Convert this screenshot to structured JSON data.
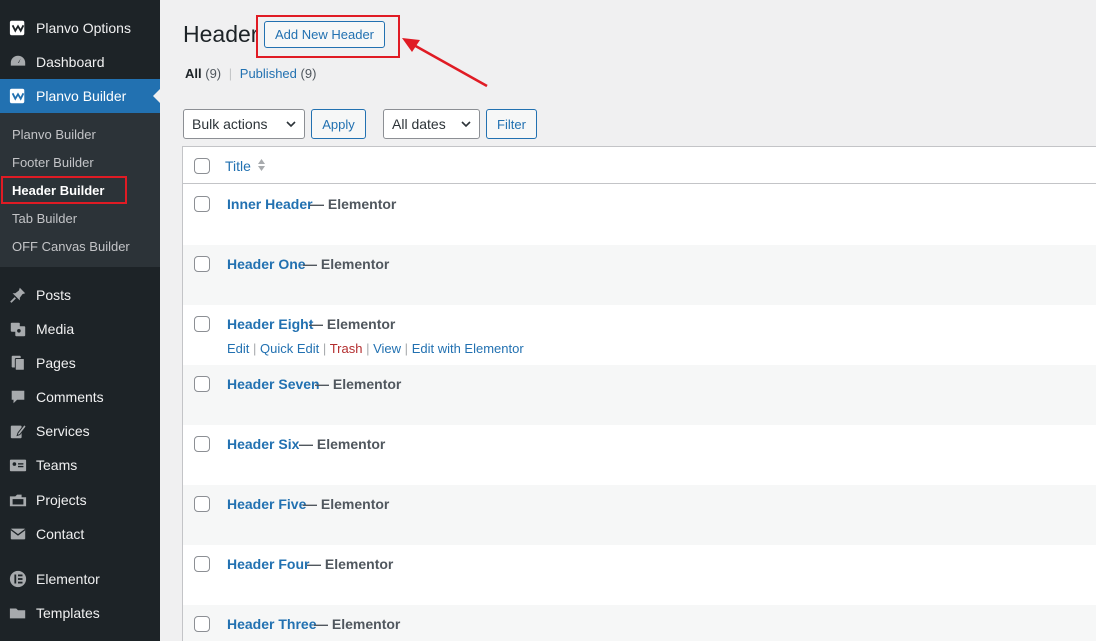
{
  "sidebar": {
    "top_items": [
      {
        "label": "Planvo Options",
        "icon": "planvo-logo-icon"
      },
      {
        "label": "Dashboard",
        "icon": "dashboard-icon"
      },
      {
        "label": "Planvo Builder",
        "icon": "planvo-logo-icon",
        "active": true
      }
    ],
    "submenu": [
      "Planvo Builder",
      "Footer Builder",
      "Header Builder",
      "Tab Builder",
      "OFF Canvas Builder"
    ],
    "submenu_current": "Header Builder",
    "bottom_items": [
      {
        "label": "Posts",
        "icon": "pushpin-icon"
      },
      {
        "label": "Media",
        "icon": "media-icon"
      },
      {
        "label": "Pages",
        "icon": "pages-icon"
      },
      {
        "label": "Comments",
        "icon": "comment-icon"
      },
      {
        "label": "Services",
        "icon": "edit-page-icon"
      },
      {
        "label": "Teams",
        "icon": "id-card-icon"
      },
      {
        "label": "Projects",
        "icon": "portfolio-icon"
      },
      {
        "label": "Contact",
        "icon": "email-icon"
      },
      {
        "label": "Elementor",
        "icon": "elementor-icon"
      },
      {
        "label": "Templates",
        "icon": "folder-icon"
      }
    ]
  },
  "page": {
    "title": "Header",
    "add_new_label": "Add New Header"
  },
  "filters": {
    "all_label": "All",
    "all_count": "(9)",
    "separator": "|",
    "published_label": "Published",
    "published_count": "(9)"
  },
  "toolbar": {
    "bulk_actions": "Bulk actions",
    "apply": "Apply",
    "dates": "All dates",
    "filter": "Filter"
  },
  "table": {
    "column_title": "Title",
    "post_state": "— Elementor",
    "rows": [
      {
        "title": "Inner Header"
      },
      {
        "title": "Header One"
      },
      {
        "title": "Header Eight"
      },
      {
        "title": "Header Seven"
      },
      {
        "title": "Header Six"
      },
      {
        "title": "Header Five"
      },
      {
        "title": "Header Four"
      },
      {
        "title": "Header Three"
      }
    ],
    "row_actions": {
      "edit": "Edit",
      "quick_edit": "Quick Edit",
      "trash": "Trash",
      "view": "View",
      "edit_with": "Edit with Elementor",
      "sep": "|"
    }
  },
  "colors": {
    "admin_bar": "#1d2327",
    "accent": "#2271b1",
    "highlight": "#e01b24"
  }
}
